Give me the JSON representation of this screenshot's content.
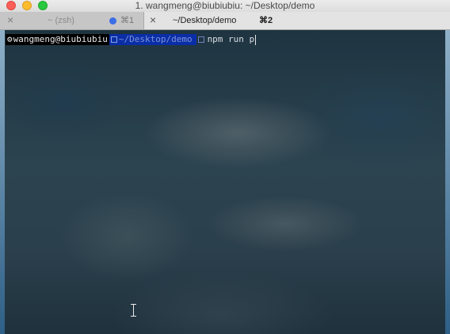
{
  "window": {
    "title": "1. wangmeng@biubiubiu: ~/Desktop/demo",
    "traffic_lights": [
      "close-button",
      "minimize-button",
      "zoom-button"
    ]
  },
  "tabs": [
    {
      "label": "~ (zsh)",
      "shortcut": "⌘1",
      "active": false,
      "has_activity_dot": true,
      "close_icon": "×"
    },
    {
      "label": "~/Desktop/demo",
      "shortcut": "⌘2",
      "active": true,
      "has_activity_dot": false,
      "close_icon": "×"
    }
  ],
  "terminal": {
    "prompt": {
      "user_host": "wangmeng@biubiubiu",
      "directory": "~/Desktop/demo",
      "user_icon": "gear-icon",
      "directory_icon": "folder-icon"
    },
    "command": "npm run p",
    "colors": {
      "user_segment_bg": "#000000",
      "directory_segment_bg": "#0a2ea6",
      "text": "#d8dde3"
    }
  }
}
